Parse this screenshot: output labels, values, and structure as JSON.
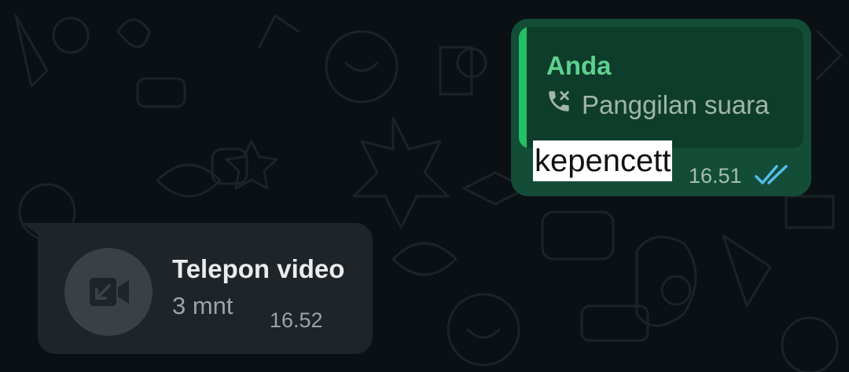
{
  "outgoing_message": {
    "quoted": {
      "author": "Anda",
      "icon": "call-icon",
      "text": "Panggilan suara"
    },
    "text": "kepencett",
    "time": "16.51",
    "status_icon": "double-check-read-icon",
    "status_color": "#53bdeb"
  },
  "incoming_call": {
    "icon": "video-missed-call-icon",
    "title": "Telepon video",
    "duration": "3 mnt",
    "time": "16.52"
  },
  "colors": {
    "background": "#0b1014",
    "outgoing_bubble": "#134d37",
    "quote_bar": "#21c063",
    "incoming_bubble": "#1e2428"
  }
}
